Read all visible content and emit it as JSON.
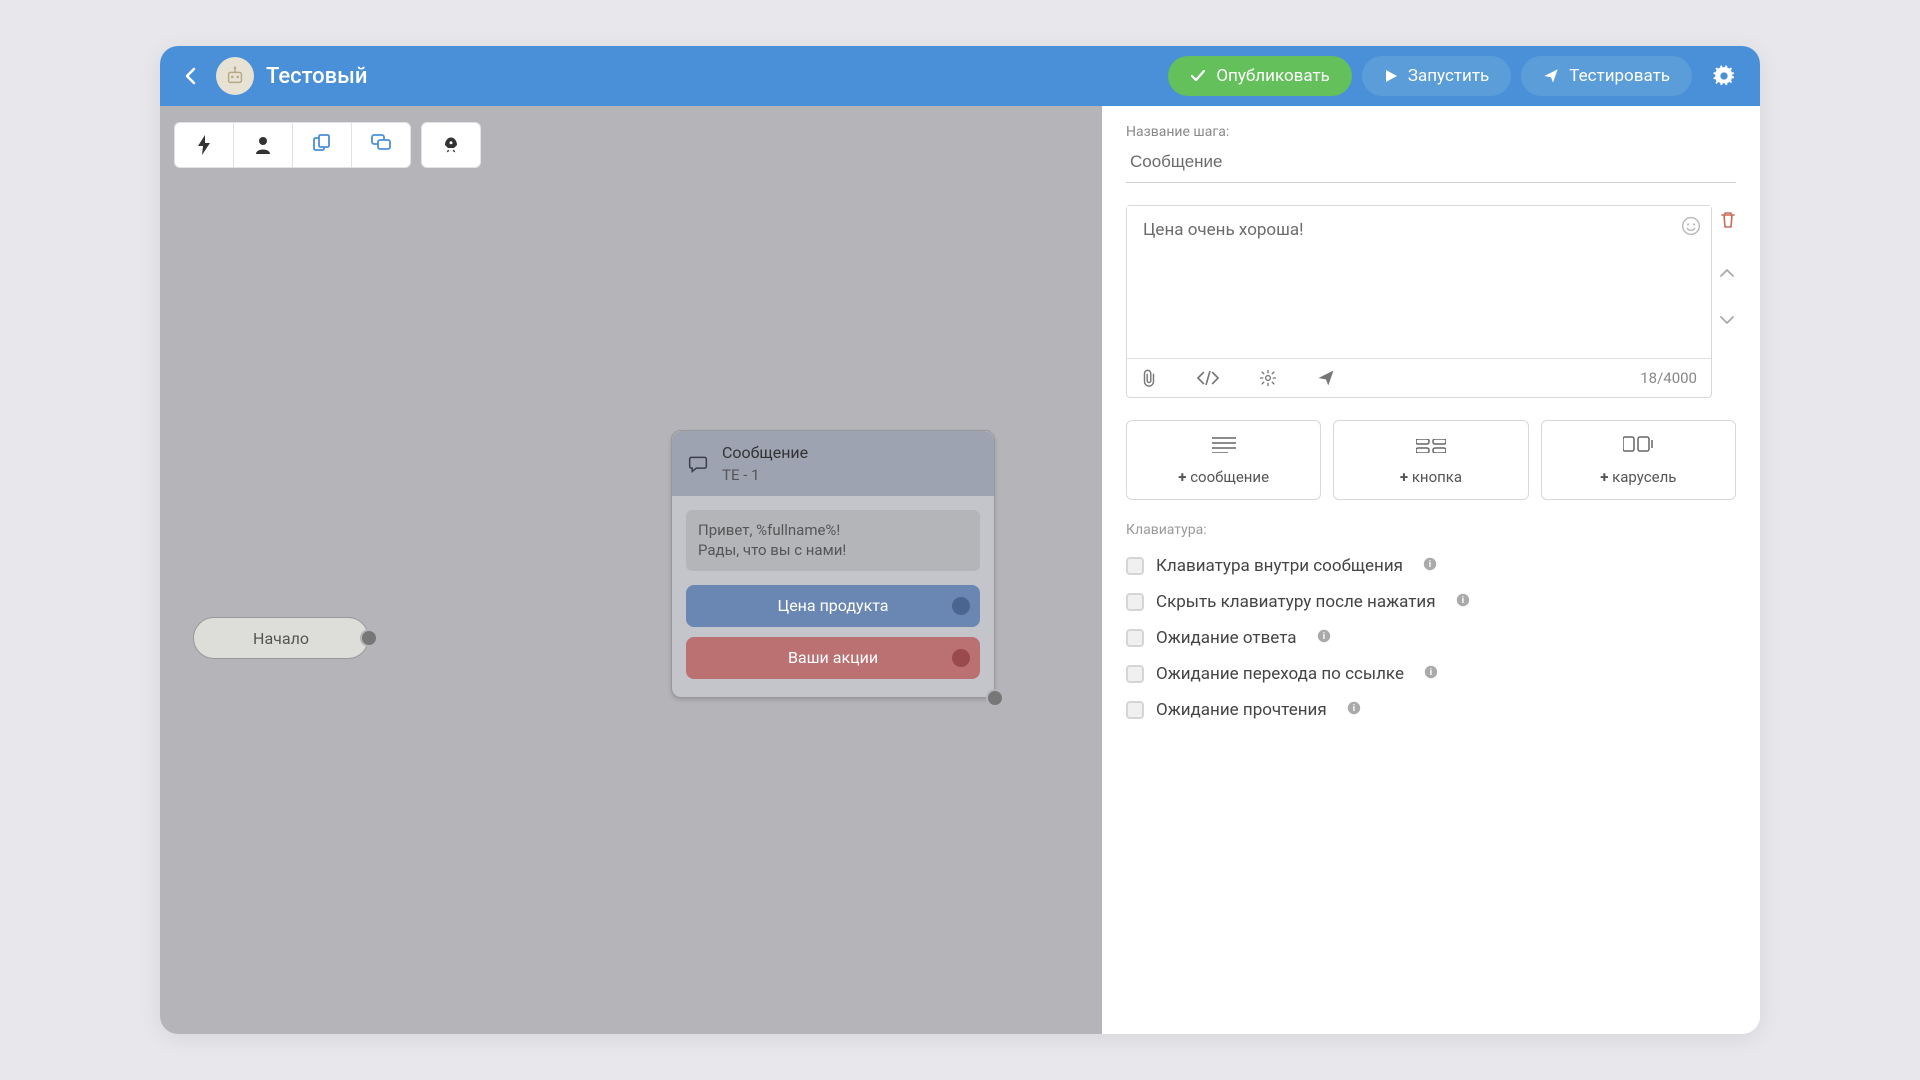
{
  "header": {
    "title": "Тестовый",
    "publish": "Опубликовать",
    "run": "Запустить",
    "test": "Тестировать"
  },
  "canvas": {
    "start_label": "Начало",
    "node": {
      "title": "Сообщение",
      "subtitle": "TE - 1",
      "text_line1": "Привет, %fullname%!",
      "text_line2": "Рады, что вы с нами!",
      "btn_blue": "Цена продукта",
      "btn_red": "Ваши акции"
    }
  },
  "sidebar": {
    "step_name_label": "Название шага:",
    "step_name": "Сообщение",
    "message_text": "Цена очень хороша!",
    "counter": "18/4000",
    "add": {
      "message": "сообщение",
      "button": "кнопка",
      "carousel": "карусель"
    },
    "keyboard_label": "Клавиатура:",
    "checks": [
      {
        "label": "Клавиатура внутри сообщения"
      },
      {
        "label": "Скрыть клавиатуру после нажатия"
      },
      {
        "label": "Ожидание ответа"
      },
      {
        "label": "Ожидание перехода по ссылке"
      },
      {
        "label": "Ожидание прочтения"
      }
    ]
  }
}
